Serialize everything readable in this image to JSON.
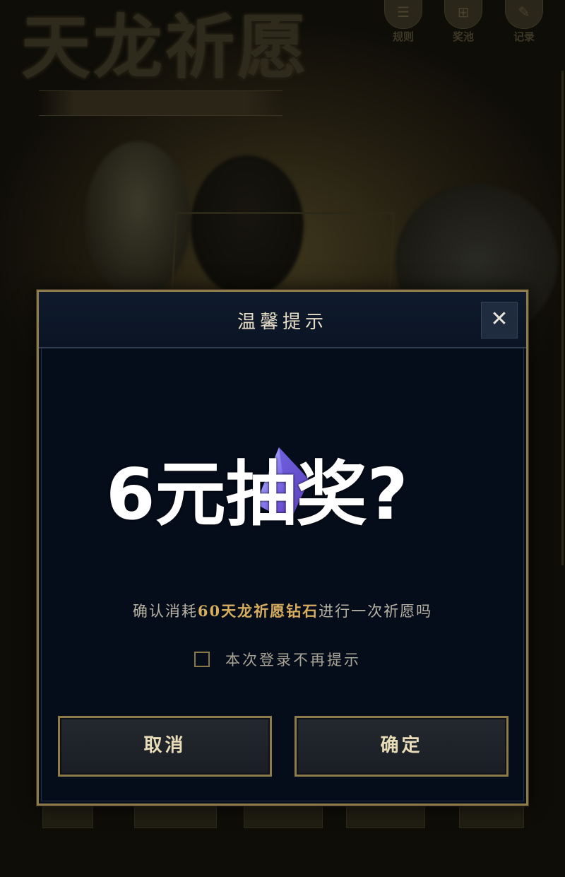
{
  "background": {
    "title": "天龙祈愿",
    "top_icons": [
      {
        "icon": "rules-icon",
        "glyph": "☰",
        "label": "规则"
      },
      {
        "icon": "reward-icon",
        "glyph": "⊞",
        "label": "奖池"
      },
      {
        "icon": "record-icon",
        "glyph": "✎",
        "label": "记录"
      }
    ]
  },
  "dialog": {
    "title": "温馨提示",
    "close_glyph": "✕",
    "overlay_caption": "6元抽奖?",
    "confirm_prefix": "确认消耗",
    "confirm_highlight": "60天龙祈愿钻石",
    "confirm_suffix": "进行一次祈愿吗",
    "checkbox_label": "本次登录不再提示",
    "checkbox_checked": false,
    "cancel_label": "取消",
    "ok_label": "确定"
  },
  "colors": {
    "dialog_border": "#8f7a49",
    "dialog_bg": "#050c1a",
    "highlight": "#d6ad5e"
  }
}
